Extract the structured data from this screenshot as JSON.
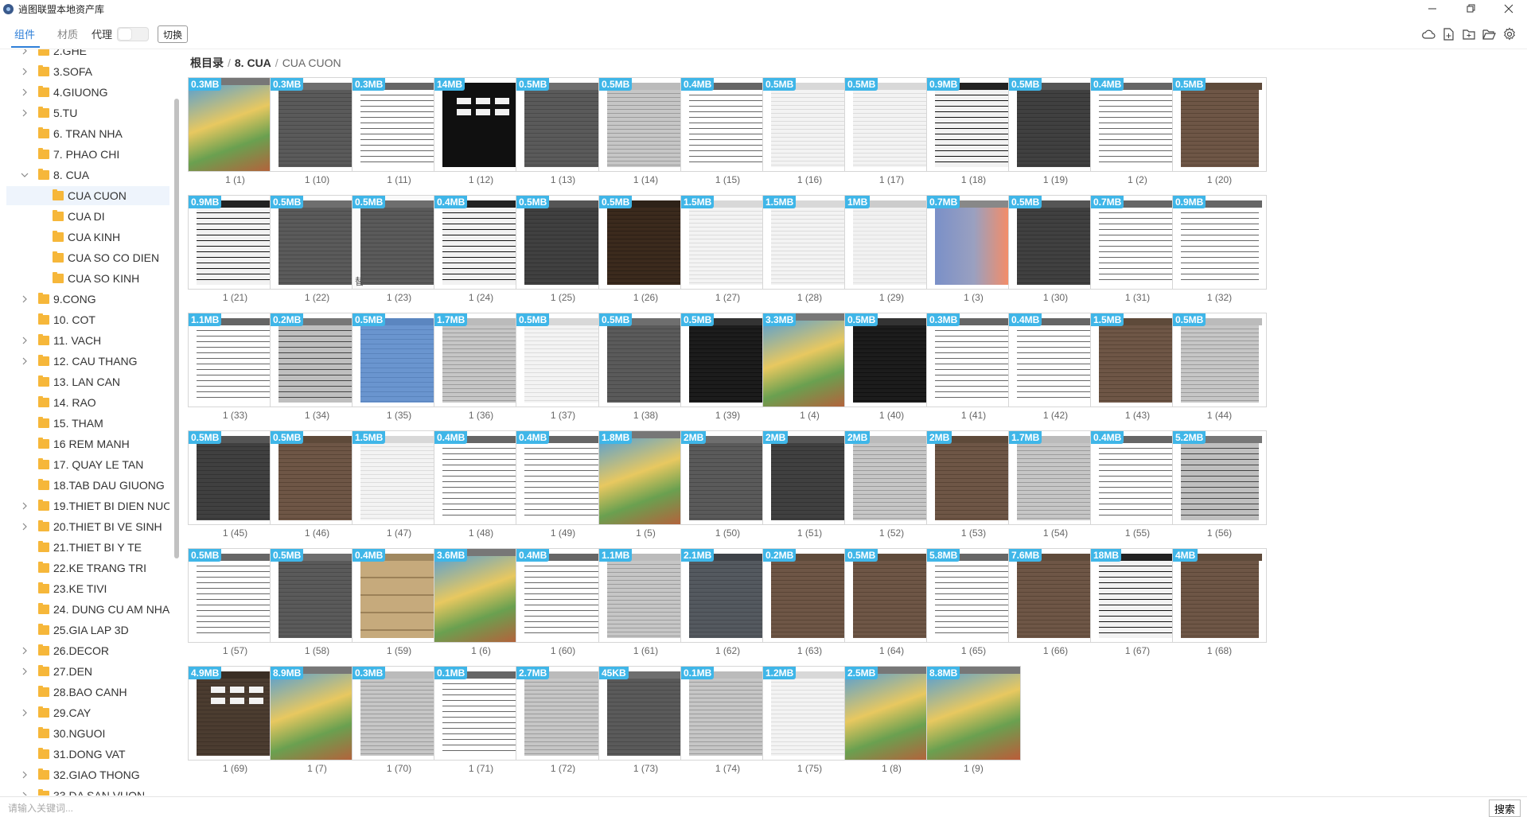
{
  "window": {
    "title": "逍图联盟本地资产库"
  },
  "tabs": [
    {
      "label": "组件"
    },
    {
      "label": "材质"
    }
  ],
  "proxy": {
    "label": "代理",
    "enabled": false
  },
  "switch_label": "切换",
  "toolbar_icons": [
    "cloud-icon",
    "new-file-icon",
    "new-folder-icon",
    "open-folder-icon",
    "settings-icon"
  ],
  "sidebar": {
    "items": [
      {
        "label": "2.GHE",
        "level": 0,
        "expander": "right"
      },
      {
        "label": "3.SOFA",
        "level": 0,
        "expander": "right"
      },
      {
        "label": "4.GIUONG",
        "level": 0,
        "expander": "right"
      },
      {
        "label": "5.TU",
        "level": 0,
        "expander": "right"
      },
      {
        "label": "6. TRAN NHA",
        "level": 0,
        "expander": ""
      },
      {
        "label": "7. PHAO CHI",
        "level": 0,
        "expander": ""
      },
      {
        "label": "8. CUA",
        "level": 0,
        "expander": "down"
      },
      {
        "label": "CUA CUON",
        "level": 1,
        "expander": "",
        "selected": true
      },
      {
        "label": "CUA DI",
        "level": 1,
        "expander": ""
      },
      {
        "label": "CUA KINH",
        "level": 1,
        "expander": ""
      },
      {
        "label": "CUA SO CO DIEN",
        "level": 1,
        "expander": ""
      },
      {
        "label": "CUA SO KINH",
        "level": 1,
        "expander": ""
      },
      {
        "label": "9.CONG",
        "level": 0,
        "expander": "right"
      },
      {
        "label": "10. COT",
        "level": 0,
        "expander": ""
      },
      {
        "label": "11. VACH",
        "level": 0,
        "expander": "right"
      },
      {
        "label": "12. CAU THANG",
        "level": 0,
        "expander": "right"
      },
      {
        "label": "13. LAN CAN",
        "level": 0,
        "expander": ""
      },
      {
        "label": "14. RAO",
        "level": 0,
        "expander": ""
      },
      {
        "label": "15. THAM",
        "level": 0,
        "expander": ""
      },
      {
        "label": "16 REM MANH",
        "level": 0,
        "expander": ""
      },
      {
        "label": "17. QUAY LE TAN",
        "level": 0,
        "expander": ""
      },
      {
        "label": "18.TAB DAU GIUONG",
        "level": 0,
        "expander": ""
      },
      {
        "label": "19.THIET BI DIEN NUOC",
        "level": 0,
        "expander": "right"
      },
      {
        "label": "20.THIET BI VE SINH",
        "level": 0,
        "expander": "right"
      },
      {
        "label": "21.THIET BI Y TE",
        "level": 0,
        "expander": ""
      },
      {
        "label": "22.KE TRANG TRI",
        "level": 0,
        "expander": ""
      },
      {
        "label": "23.KE TIVI",
        "level": 0,
        "expander": ""
      },
      {
        "label": "24. DUNG CU AM NHAC",
        "level": 0,
        "expander": ""
      },
      {
        "label": "25.GIA LAP 3D",
        "level": 0,
        "expander": ""
      },
      {
        "label": "26.DECOR",
        "level": 0,
        "expander": "right"
      },
      {
        "label": "27.DEN",
        "level": 0,
        "expander": "right"
      },
      {
        "label": "28.BAO CANH",
        "level": 0,
        "expander": ""
      },
      {
        "label": "29.CAY",
        "level": 0,
        "expander": "right"
      },
      {
        "label": "30.NGUOI",
        "level": 0,
        "expander": ""
      },
      {
        "label": "31.DONG VAT",
        "level": 0,
        "expander": ""
      },
      {
        "label": "32.GIAO THONG",
        "level": 0,
        "expander": "right"
      },
      {
        "label": "33.DA SAN VUON",
        "level": 0,
        "expander": "right"
      }
    ]
  },
  "breadcrumb": {
    "root": "根目录",
    "sep": "/",
    "parent": "8. CUA",
    "current": "CUA CUON"
  },
  "grid": {
    "hover_index": 15,
    "hover_text": "替",
    "items": [
      {
        "size": "0.3MB",
        "name": "1 (1)",
        "style": "painting"
      },
      {
        "size": "0.3MB",
        "name": "1 (10)",
        "style": "gray"
      },
      {
        "size": "0.3MB",
        "name": "1 (11)",
        "style": "whitegrid"
      },
      {
        "size": "14MB",
        "name": "1 (12)",
        "style": "blackwin"
      },
      {
        "size": "0.5MB",
        "name": "1 (13)",
        "style": "gray"
      },
      {
        "size": "0.5MB",
        "name": "1 (14)",
        "style": "lightgray"
      },
      {
        "size": "0.4MB",
        "name": "1 (15)",
        "style": "whitegrid"
      },
      {
        "size": "0.5MB",
        "name": "1 (16)",
        "style": "white"
      },
      {
        "size": "0.5MB",
        "name": "1 (17)",
        "style": "white"
      },
      {
        "size": "0.9MB",
        "name": "1 (18)",
        "style": "blackgrid"
      },
      {
        "size": "0.5MB",
        "name": "1 (19)",
        "style": "darkgray"
      },
      {
        "size": "0.4MB",
        "name": "1 (2)",
        "style": "whitegrid"
      },
      {
        "size": "0.5MB",
        "name": "1 (20)",
        "style": "brown"
      },
      {
        "size": "0.9MB",
        "name": "1 (21)",
        "style": "blackgrid"
      },
      {
        "size": "0.5MB",
        "name": "1 (22)",
        "style": "gray"
      },
      {
        "size": "0.5MB",
        "name": "1 (23)",
        "style": "gray"
      },
      {
        "size": "0.4MB",
        "name": "1 (24)",
        "style": "blackgrid"
      },
      {
        "size": "0.5MB",
        "name": "1 (25)",
        "style": "darkgray"
      },
      {
        "size": "0.5MB",
        "name": "1 (26)",
        "style": "darkbrown"
      },
      {
        "size": "1.5MB",
        "name": "1 (27)",
        "style": "white"
      },
      {
        "size": "1.5MB",
        "name": "1 (28)",
        "style": "white"
      },
      {
        "size": "1MB",
        "name": "1 (29)",
        "style": "whitewin"
      },
      {
        "size": "0.7MB",
        "name": "1 (3)",
        "style": "gradient"
      },
      {
        "size": "0.5MB",
        "name": "1 (30)",
        "style": "darkgray"
      },
      {
        "size": "0.7MB",
        "name": "1 (31)",
        "style": "whitegrid"
      },
      {
        "size": "0.9MB",
        "name": "1 (32)",
        "style": "whitegrid"
      },
      {
        "size": "1.1MB",
        "name": "1 (33)",
        "style": "whitegrid"
      },
      {
        "size": "0.2MB",
        "name": "1 (34)",
        "style": "graygrid"
      },
      {
        "size": "0.5MB",
        "name": "1 (35)",
        "style": "blue"
      },
      {
        "size": "1.7MB",
        "name": "1 (36)",
        "style": "lightgray"
      },
      {
        "size": "0.5MB",
        "name": "1 (37)",
        "style": "white"
      },
      {
        "size": "0.5MB",
        "name": "1 (38)",
        "style": "gray"
      },
      {
        "size": "0.5MB",
        "name": "1 (39)",
        "style": "black"
      },
      {
        "size": "3.3MB",
        "name": "1 (4)",
        "style": "painting"
      },
      {
        "size": "0.5MB",
        "name": "1 (40)",
        "style": "black"
      },
      {
        "size": "0.3MB",
        "name": "1 (41)",
        "style": "whitegrid"
      },
      {
        "size": "0.4MB",
        "name": "1 (42)",
        "style": "whitegrid"
      },
      {
        "size": "1.5MB",
        "name": "1 (43)",
        "style": "brown"
      },
      {
        "size": "0.5MB",
        "name": "1 (44)",
        "style": "lightgray"
      },
      {
        "size": "0.5MB",
        "name": "1 (45)",
        "style": "darkgray"
      },
      {
        "size": "0.5MB",
        "name": "1 (46)",
        "style": "brown"
      },
      {
        "size": "1.5MB",
        "name": "1 (47)",
        "style": "white"
      },
      {
        "size": "0.4MB",
        "name": "1 (48)",
        "style": "whitegrid"
      },
      {
        "size": "0.4MB",
        "name": "1 (49)",
        "style": "whitegrid"
      },
      {
        "size": "1.8MB",
        "name": "1 (5)",
        "style": "painting"
      },
      {
        "size": "2MB",
        "name": "1 (50)",
        "style": "gray"
      },
      {
        "size": "2MB",
        "name": "1 (51)",
        "style": "darkgray"
      },
      {
        "size": "2MB",
        "name": "1 (52)",
        "style": "lightgray"
      },
      {
        "size": "2MB",
        "name": "1 (53)",
        "style": "brown"
      },
      {
        "size": "1.7MB",
        "name": "1 (54)",
        "style": "lightgray"
      },
      {
        "size": "0.4MB",
        "name": "1 (55)",
        "style": "whitegrid"
      },
      {
        "size": "5.2MB",
        "name": "1 (56)",
        "style": "graygrid"
      },
      {
        "size": "0.5MB",
        "name": "1 (57)",
        "style": "whitegrid"
      },
      {
        "size": "0.5MB",
        "name": "1 (58)",
        "style": "gray"
      },
      {
        "size": "0.4MB",
        "name": "1 (59)",
        "style": "tan"
      },
      {
        "size": "3.6MB",
        "name": "1 (6)",
        "style": "painting"
      },
      {
        "size": "0.4MB",
        "name": "1 (60)",
        "style": "whitegrid"
      },
      {
        "size": "1.1MB",
        "name": "1 (61)",
        "style": "lightgray"
      },
      {
        "size": "2.1MB",
        "name": "1 (62)",
        "style": "slate"
      },
      {
        "size": "0.2MB",
        "name": "1 (63)",
        "style": "brown"
      },
      {
        "size": "0.5MB",
        "name": "1 (64)",
        "style": "brown"
      },
      {
        "size": "5.8MB",
        "name": "1 (65)",
        "style": "whitegrid"
      },
      {
        "size": "7.6MB",
        "name": "1 (66)",
        "style": "brown"
      },
      {
        "size": "18MB",
        "name": "1 (67)",
        "style": "blackgrid"
      },
      {
        "size": "4MB",
        "name": "1 (68)",
        "style": "brown"
      },
      {
        "size": "4.9MB",
        "name": "1 (69)",
        "style": "brownwin"
      },
      {
        "size": "8.9MB",
        "name": "1 (7)",
        "style": "painting"
      },
      {
        "size": "0.3MB",
        "name": "1 (70)",
        "style": "lightgray"
      },
      {
        "size": "0.1MB",
        "name": "1 (71)",
        "style": "whitegrid"
      },
      {
        "size": "2.7MB",
        "name": "1 (72)",
        "style": "lightgray"
      },
      {
        "size": "45KB",
        "name": "1 (73)",
        "style": "gray"
      },
      {
        "size": "0.1MB",
        "name": "1 (74)",
        "style": "lightgray"
      },
      {
        "size": "1.2MB",
        "name": "1 (75)",
        "style": "white"
      },
      {
        "size": "2.5MB",
        "name": "1 (8)",
        "style": "painting"
      },
      {
        "size": "8.8MB",
        "name": "1 (9)",
        "style": "painting"
      }
    ]
  },
  "search": {
    "placeholder": "请输入关键词...",
    "value": "",
    "button_label": "搜索"
  },
  "colors": {
    "accent": "#2e7fd8",
    "badge": "#3fb6e8",
    "folder": "#f6b73a",
    "selected_bg": "#eef4fc"
  }
}
